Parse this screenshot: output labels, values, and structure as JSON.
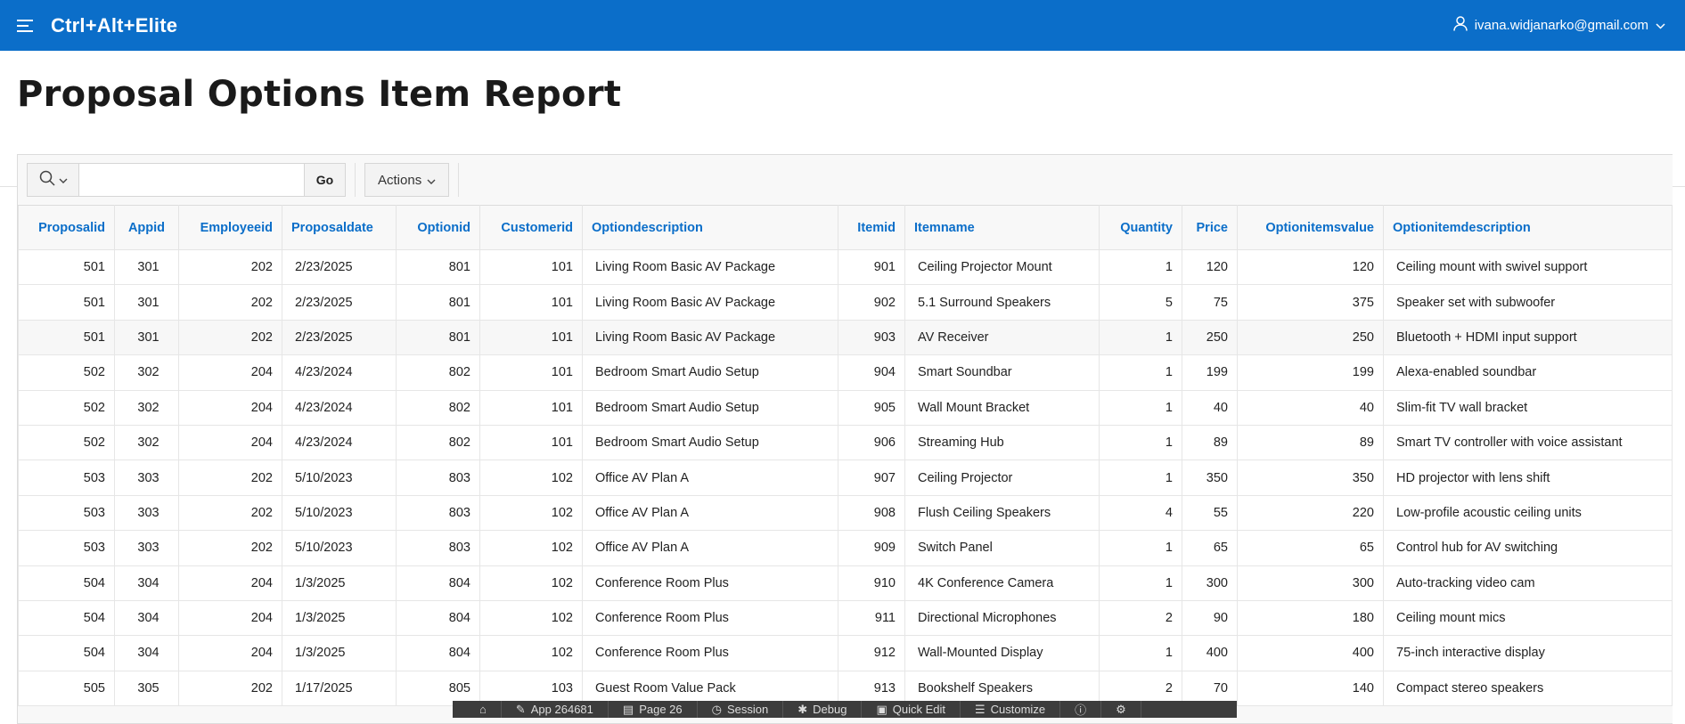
{
  "app": {
    "title": "Ctrl+Alt+Elite",
    "user_email": "ivana.widjanarko@gmail.com"
  },
  "page": {
    "title": "Proposal Options Item Report"
  },
  "toolbar": {
    "search_placeholder": "",
    "go_label": "Go",
    "actions_label": "Actions"
  },
  "table": {
    "columns": [
      "Proposalid",
      "Appid",
      "Employeeid",
      "Proposaldate",
      "Optionid",
      "Customerid",
      "Optiondescription",
      "Itemid",
      "Itemname",
      "Quantity",
      "Price",
      "Optionitemsvalue",
      "Optionitemdescription"
    ],
    "rows": [
      [
        "501",
        "301",
        "202",
        "2/23/2025",
        "801",
        "101",
        "Living Room Basic AV Package",
        "901",
        "Ceiling Projector Mount",
        "1",
        "120",
        "120",
        "Ceiling mount with swivel support"
      ],
      [
        "501",
        "301",
        "202",
        "2/23/2025",
        "801",
        "101",
        "Living Room Basic AV Package",
        "902",
        "5.1 Surround Speakers",
        "5",
        "75",
        "375",
        "Speaker set with subwoofer"
      ],
      [
        "501",
        "301",
        "202",
        "2/23/2025",
        "801",
        "101",
        "Living Room Basic AV Package",
        "903",
        "AV Receiver",
        "1",
        "250",
        "250",
        "Bluetooth + HDMI input support"
      ],
      [
        "502",
        "302",
        "204",
        "4/23/2024",
        "802",
        "101",
        "Bedroom Smart Audio Setup",
        "904",
        "Smart Soundbar",
        "1",
        "199",
        "199",
        "Alexa-enabled soundbar"
      ],
      [
        "502",
        "302",
        "204",
        "4/23/2024",
        "802",
        "101",
        "Bedroom Smart Audio Setup",
        "905",
        "Wall Mount Bracket",
        "1",
        "40",
        "40",
        "Slim-fit TV wall bracket"
      ],
      [
        "502",
        "302",
        "204",
        "4/23/2024",
        "802",
        "101",
        "Bedroom Smart Audio Setup",
        "906",
        "Streaming Hub",
        "1",
        "89",
        "89",
        "Smart TV controller with voice assistant"
      ],
      [
        "503",
        "303",
        "202",
        "5/10/2023",
        "803",
        "102",
        "Office AV Plan A",
        "907",
        "Ceiling Projector",
        "1",
        "350",
        "350",
        "HD projector with lens shift"
      ],
      [
        "503",
        "303",
        "202",
        "5/10/2023",
        "803",
        "102",
        "Office AV Plan A",
        "908",
        "Flush Ceiling Speakers",
        "4",
        "55",
        "220",
        "Low-profile acoustic ceiling units"
      ],
      [
        "503",
        "303",
        "202",
        "5/10/2023",
        "803",
        "102",
        "Office AV Plan A",
        "909",
        "Switch Panel",
        "1",
        "65",
        "65",
        "Control hub for AV switching"
      ],
      [
        "504",
        "304",
        "204",
        "1/3/2025",
        "804",
        "102",
        "Conference Room Plus",
        "910",
        "4K Conference Camera",
        "1",
        "300",
        "300",
        "Auto-tracking video cam"
      ],
      [
        "504",
        "304",
        "204",
        "1/3/2025",
        "804",
        "102",
        "Conference Room Plus",
        "911",
        "Directional Microphones",
        "2",
        "90",
        "180",
        "Ceiling mount mics"
      ],
      [
        "504",
        "304",
        "204",
        "1/3/2025",
        "804",
        "102",
        "Conference Room Plus",
        "912",
        "Wall-Mounted Display",
        "1",
        "400",
        "400",
        "75-inch interactive display"
      ],
      [
        "505",
        "305",
        "202",
        "1/17/2025",
        "805",
        "103",
        "Guest Room Value Pack",
        "913",
        "Bookshelf Speakers",
        "2",
        "70",
        "140",
        "Compact stereo speakers"
      ]
    ]
  },
  "devbar": {
    "items": [
      "App 264681",
      "Page 26",
      "Session",
      "Debug",
      "Quick Edit",
      "Customize"
    ]
  },
  "colors": {
    "brand": "#0b6ec9",
    "header_text": "#0b6ec9"
  }
}
